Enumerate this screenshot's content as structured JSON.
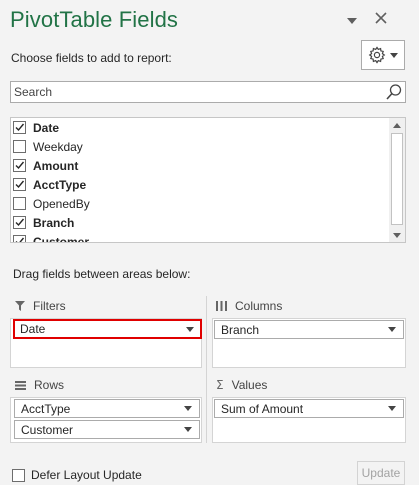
{
  "pane": {
    "title": "PivotTable Fields",
    "subtitle": "Choose fields to add to report:",
    "search_placeholder": "Search"
  },
  "fields": [
    {
      "label": "Date",
      "checked": true,
      "bold": true
    },
    {
      "label": "Weekday",
      "checked": false,
      "bold": false
    },
    {
      "label": "Amount",
      "checked": true,
      "bold": true
    },
    {
      "label": "AcctType",
      "checked": true,
      "bold": true
    },
    {
      "label": "OpenedBy",
      "checked": false,
      "bold": false
    },
    {
      "label": "Branch",
      "checked": true,
      "bold": true
    },
    {
      "label": "Customer",
      "checked": true,
      "bold": true
    }
  ],
  "areas": {
    "drag_label": "Drag fields between areas below:",
    "filters": {
      "label": "Filters",
      "items": [
        "Date"
      ]
    },
    "columns": {
      "label": "Columns",
      "items": [
        "Branch"
      ]
    },
    "rows": {
      "label": "Rows",
      "items": [
        "AcctType",
        "Customer"
      ]
    },
    "values": {
      "label": "Values",
      "items": [
        "Sum of Amount"
      ]
    }
  },
  "footer": {
    "defer_label": "Defer Layout Update",
    "defer_checked": false,
    "update_label": "Update"
  },
  "icons": {
    "pane_menu": "chevron-down-icon",
    "close": "close-icon",
    "tools": "gear-icon",
    "search": "search-icon",
    "filters": "filter-icon",
    "columns": "columns-icon",
    "rows": "rows-icon",
    "values": "sigma-icon"
  },
  "colors": {
    "title": "#217346",
    "selection_border": "#e00000"
  }
}
